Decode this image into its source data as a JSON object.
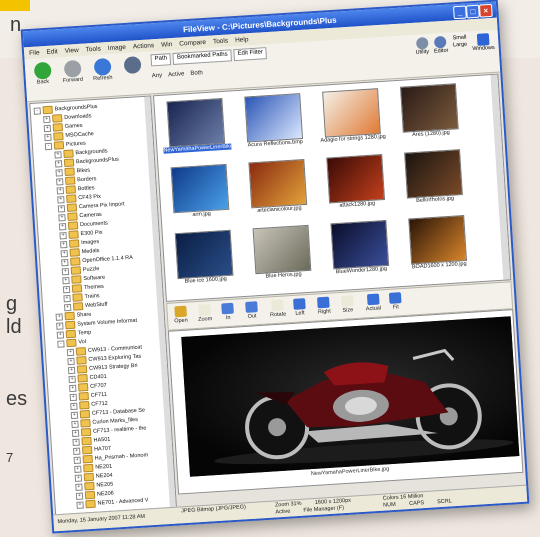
{
  "magazine": {
    "left_fragments": [
      "n",
      "g",
      "ld",
      "es"
    ],
    "page_number": "7"
  },
  "window": {
    "title": "FileView - C:\\Pictures\\Backgrounds\\Plus"
  },
  "menu": [
    "File",
    "Edit",
    "View",
    "Tools",
    "Image",
    "Actions",
    "Win",
    "Compare",
    "Tools",
    "Help"
  ],
  "toolbar": {
    "buttons": [
      {
        "label": "Back",
        "icon": "back-arrow-icon",
        "color": "#2fa53a"
      },
      {
        "label": "Forward",
        "icon": "forward-arrow-icon",
        "color": "#9aa0a6"
      },
      {
        "label": "Refresh",
        "icon": "refresh-icon",
        "color": "#3a78d8"
      },
      {
        "label": "",
        "icon": "view-list-icon",
        "color": "#5a6e8c"
      }
    ],
    "address_tabs": [
      "Path",
      "Bookmarked Paths",
      "Edit Filter"
    ],
    "filter_options": [
      "Any",
      "Active",
      "Both"
    ],
    "right_buttons": [
      "Utility",
      "Editor"
    ],
    "size_options": [
      "Small",
      "Large"
    ],
    "right_extra": "Windows"
  },
  "tree": {
    "items": [
      {
        "label": "BackgroundsPlus",
        "indent": 0,
        "plus": "-"
      },
      {
        "label": "Downloads",
        "indent": 1,
        "plus": "+"
      },
      {
        "label": "Games",
        "indent": 1,
        "plus": "+"
      },
      {
        "label": "MSOCache",
        "indent": 1,
        "plus": "+"
      },
      {
        "label": "Pictures",
        "indent": 1,
        "plus": "-"
      },
      {
        "label": "Backgrounds",
        "indent": 2,
        "plus": "+"
      },
      {
        "label": "BackgroundsPlus",
        "indent": 2,
        "plus": "+"
      },
      {
        "label": "Bikes",
        "indent": 2,
        "plus": "+"
      },
      {
        "label": "Borders",
        "indent": 2,
        "plus": "+"
      },
      {
        "label": "Bottles",
        "indent": 2,
        "plus": "+"
      },
      {
        "label": "CF43 Pix",
        "indent": 2,
        "plus": "+"
      },
      {
        "label": "Camera Pix Import",
        "indent": 2,
        "plus": "+"
      },
      {
        "label": "Cameras",
        "indent": 2,
        "plus": "+"
      },
      {
        "label": "Documents",
        "indent": 2,
        "plus": "+"
      },
      {
        "label": "E300 Pix",
        "indent": 2,
        "plus": "+"
      },
      {
        "label": "Images",
        "indent": 2,
        "plus": "+"
      },
      {
        "label": "Medals",
        "indent": 2,
        "plus": "+"
      },
      {
        "label": "OpenOffice 1.1.4 RA",
        "indent": 2,
        "plus": "+"
      },
      {
        "label": "Puzzle",
        "indent": 2,
        "plus": "+"
      },
      {
        "label": "Software",
        "indent": 2,
        "plus": "+"
      },
      {
        "label": "Themes",
        "indent": 2,
        "plus": "+"
      },
      {
        "label": "Trains",
        "indent": 2,
        "plus": "+"
      },
      {
        "label": "WebStuff",
        "indent": 2,
        "plus": "+"
      },
      {
        "label": "Share",
        "indent": 1,
        "plus": "+"
      },
      {
        "label": "System Volume Informat",
        "indent": 1,
        "plus": "+"
      },
      {
        "label": "Temp",
        "indent": 1,
        "plus": "+"
      },
      {
        "label": "Vol",
        "indent": 1,
        "plus": "-"
      },
      {
        "label": "CW913 - Communicat",
        "indent": 2,
        "plus": "+"
      },
      {
        "label": "CW913 Exploring Tas",
        "indent": 2,
        "plus": "+"
      },
      {
        "label": "CW913 Strategy Bri",
        "indent": 2,
        "plus": "+"
      },
      {
        "label": "CD401",
        "indent": 2,
        "plus": "+"
      },
      {
        "label": "CF707",
        "indent": 2,
        "plus": "+"
      },
      {
        "label": "CF711",
        "indent": 2,
        "plus": "+"
      },
      {
        "label": "CF712",
        "indent": 2,
        "plus": "+"
      },
      {
        "label": "CF713 - Database Se",
        "indent": 2,
        "plus": "+"
      },
      {
        "label": "Curlon Marks_files",
        "indent": 2,
        "plus": "+"
      },
      {
        "label": "CF713 - realtime - the",
        "indent": 2,
        "plus": "+"
      },
      {
        "label": "HA501",
        "indent": 2,
        "plus": "+"
      },
      {
        "label": "HA707",
        "indent": 2,
        "plus": "+"
      },
      {
        "label": "Ha_Prismah - Monom",
        "indent": 2,
        "plus": "+"
      },
      {
        "label": "NE201",
        "indent": 2,
        "plus": "+"
      },
      {
        "label": "NE204",
        "indent": 2,
        "plus": "+"
      },
      {
        "label": "NE205",
        "indent": 2,
        "plus": "+"
      },
      {
        "label": "NE206",
        "indent": 2,
        "plus": "+"
      },
      {
        "label": "NE701 - Advanced V",
        "indent": 2,
        "plus": "+"
      }
    ]
  },
  "thumbnails": [
    {
      "caption": "NewYamahaPowerLinerBike.jpg",
      "selected": true,
      "c1": "#1a2450",
      "c2": "#6b7fa8"
    },
    {
      "caption": "Acura Reflections.bmp",
      "selected": false,
      "c1": "#2c56b5",
      "c2": "#dbe7ff"
    },
    {
      "caption": "Adagio for strings 1280.jpg",
      "selected": false,
      "c1": "#f4efe6",
      "c2": "#e07a35"
    },
    {
      "caption": "Ares (1280).jpg",
      "selected": false,
      "c1": "#2a1a16",
      "c2": "#7a5a3c"
    },
    {
      "caption": "arm.jpg",
      "selected": false,
      "c1": "#0f3a8a",
      "c2": "#4aa0e8"
    },
    {
      "caption": "arteclanicolour.jpg",
      "selected": false,
      "c1": "#8a2a10",
      "c2": "#e2a23a"
    },
    {
      "caption": "attack1280.jpg",
      "selected": false,
      "c1": "#3a0a06",
      "c2": "#c2401c"
    },
    {
      "caption": "Bellorfhotos.jpg",
      "selected": false,
      "c1": "#1a1410",
      "c2": "#7a4a28"
    },
    {
      "caption": "Blue ice 1600.jpg",
      "selected": false,
      "c1": "#0a1e44",
      "c2": "#2a4e88"
    },
    {
      "caption": "Blue Heros.jpg",
      "selected": false,
      "c1": "#c8c4b8",
      "c2": "#6a6a5a"
    },
    {
      "caption": "BlueWonder1280.jpg",
      "selected": false,
      "c1": "#0a0e2a",
      "c2": "#3a4e9a"
    },
    {
      "caption": "BOAD1600 x 1200.jpg",
      "selected": false,
      "c1": "#2a1408",
      "c2": "#d8852a"
    }
  ],
  "viewbar": {
    "buttons": [
      {
        "label": "Open",
        "color": "#d9a62a"
      },
      {
        "label": "Zoom",
        "color": "#ece9d8"
      },
      {
        "label": "In",
        "color": "#4a7bd8"
      },
      {
        "label": "Out",
        "color": "#4a7bd8"
      },
      {
        "label": "Rotate",
        "color": "#ece9d8"
      },
      {
        "label": "Left",
        "color": "#3a6fd8"
      },
      {
        "label": "Right",
        "color": "#3a6fd8"
      },
      {
        "label": "Size",
        "color": "#ece9d8"
      },
      {
        "label": "Actual",
        "color": "#3a6fd8"
      },
      {
        "label": "Fit",
        "color": "#3a6fd8"
      }
    ]
  },
  "viewer": {
    "caption": "NewYamahaPowerLinerBike.jpg"
  },
  "status": {
    "date": "Monday, 15 January 2007 11:28 AM",
    "type": "JPEG Bitmap (JPG/JPEG)",
    "zoom": "Zoom 31%",
    "dims": "1600 x 1200px",
    "colors": "Colors 16 Million",
    "mode": "Active",
    "manager": "File Manager (F)",
    "caps": "NUM",
    "caps2": "CAPS",
    "scrl": "SCRL"
  },
  "colors": {
    "titlebar": "#1f52c8",
    "selection": "#2f64d6",
    "folder": "#f0c34e"
  }
}
